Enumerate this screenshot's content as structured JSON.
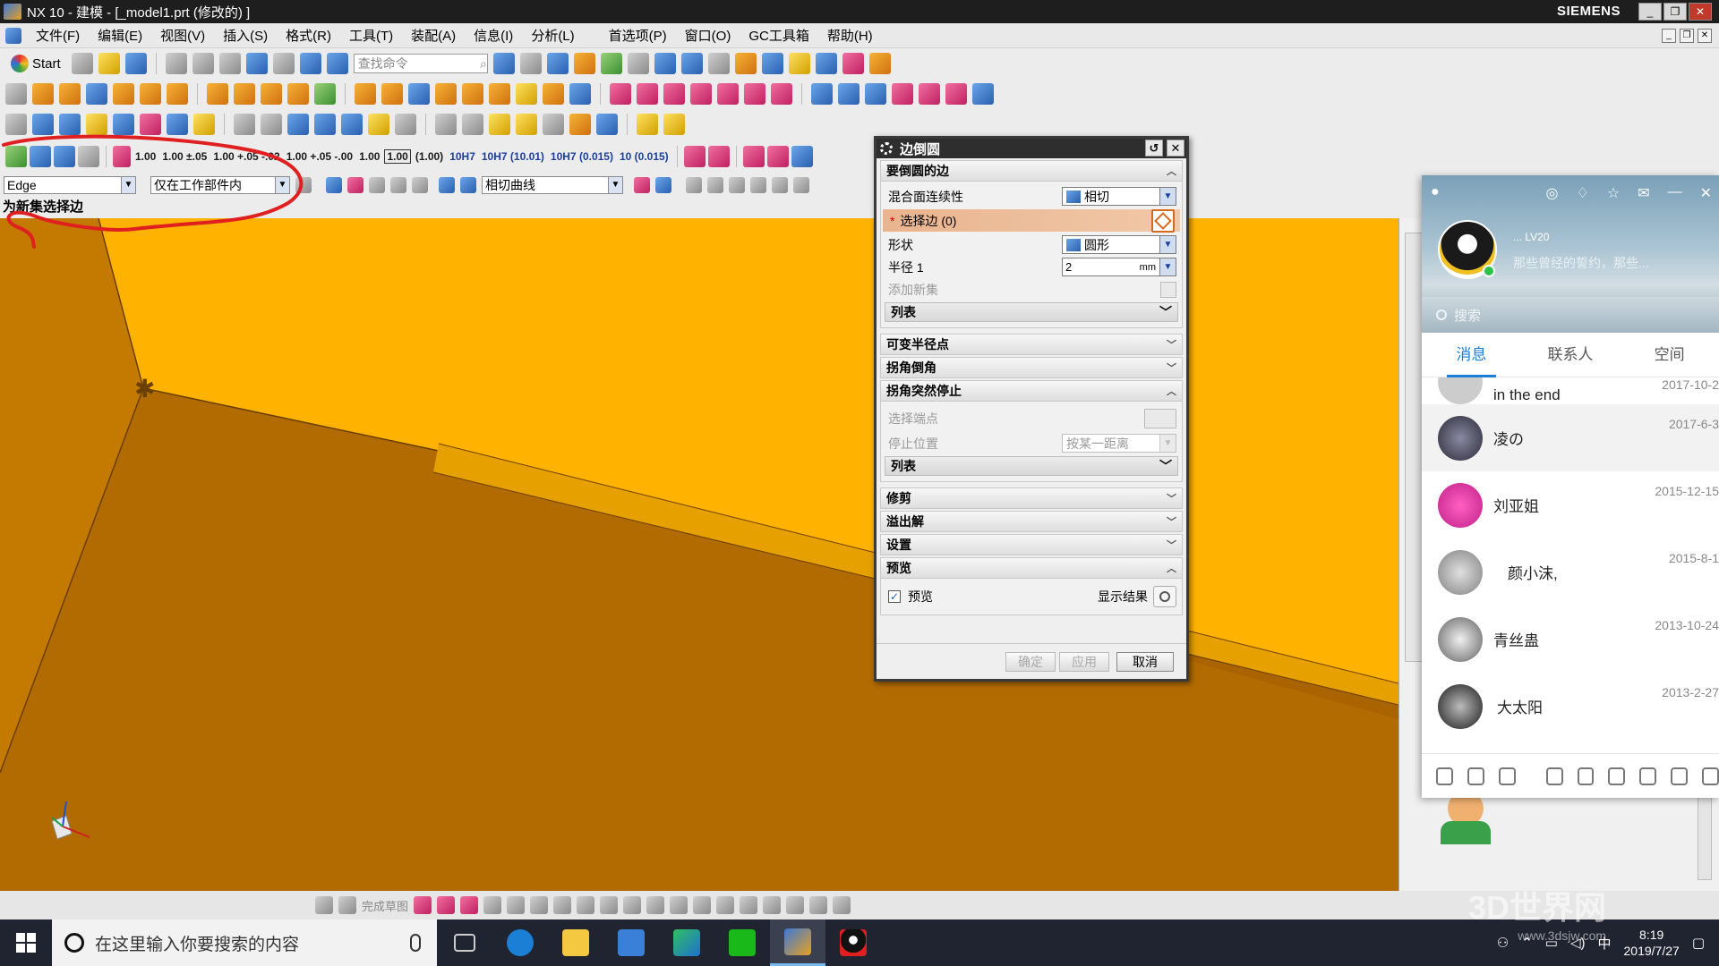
{
  "window": {
    "title": "NX 10 - 建模 - [_model1.prt  (修改的)  ]",
    "brand": "SIEMENS",
    "controls": [
      "_",
      "❐",
      "✕"
    ]
  },
  "menu": {
    "items": [
      "文件(F)",
      "编辑(E)",
      "视图(V)",
      "插入(S)",
      "格式(R)",
      "工具(T)",
      "装配(A)",
      "信息(I)",
      "分析(L)",
      "首选项(P)",
      "窗口(O)",
      "GC工具箱",
      "帮助(H)"
    ]
  },
  "toolbar": {
    "start_label": "Start",
    "search_placeholder": "查找命令",
    "dimension_labels": [
      "1.00",
      "1.00 ±.05",
      "1.00 +.05 -.02",
      "1.00 +.05 -.00",
      "1.00",
      "1.00",
      "(1.00)",
      "10H7",
      "10H7 (10.01)",
      "10H7 (0.015)",
      "10 (0.015)"
    ]
  },
  "selection_bar": {
    "filter_value": "Edge",
    "scope_value": "仅在工作部件内",
    "curve_rule": "相切曲线"
  },
  "status": {
    "prompt": "为新集选择边"
  },
  "dialog": {
    "title": "边倒圆",
    "section_edges": "要倒圆的边",
    "continuity_label": "混合面连续性",
    "continuity_value": "相切",
    "select_edge_label": "选择边 (0)",
    "shape_label": "形状",
    "shape_value": "圆形",
    "radius_label": "半径 1",
    "radius_value": "2",
    "radius_unit": "mm",
    "add_set_label": "添加新集",
    "list_label": "列表",
    "section_variable": "可变半径点",
    "section_corner_setback": "拐角倒角",
    "section_corner_stop": "拐角突然停止",
    "select_endpoint_label": "选择端点",
    "stop_position_label": "停止位置",
    "stop_position_value": "按某一距离",
    "list_label_2": "列表",
    "section_trim": "修剪",
    "section_overflow": "溢出解",
    "section_settings": "设置",
    "section_preview": "预览",
    "preview_checkbox_label": "预览",
    "show_result_label": "显示结果",
    "ok_label": "确定",
    "apply_label": "应用",
    "cancel_label": "取消"
  },
  "qq": {
    "signature": "那些曾经的誓约，那些...",
    "nickname": "... LV20",
    "search_placeholder": "搜索",
    "tabs": [
      "消息",
      "联系人",
      "空间"
    ],
    "contacts": [
      {
        "name": "in the end",
        "date": "2017-10-2"
      },
      {
        "name": "凌の",
        "date": "2017-6-3"
      },
      {
        "name": "刘亚姐",
        "date": "2015-12-15"
      },
      {
        "name": "颜小沫,",
        "date": "2015-8-1"
      },
      {
        "name": "青丝蛊",
        "date": "2013-10-24"
      },
      {
        "name": "大太阳",
        "date": "2013-2-27"
      }
    ]
  },
  "sketch_toolbar": {
    "finish_label": "完成草图"
  },
  "taskbar": {
    "search_placeholder": "在这里输入你要搜索的内容",
    "time": "8:19",
    "date": "2019/7/27",
    "ime": "中"
  },
  "watermark": {
    "text": "3D世界网",
    "url": "www.3dsjw.com"
  },
  "colors": {
    "viewport_top": "#ffb300",
    "viewport_face": "#b86e00",
    "annotation": "#e02020",
    "qq_accent": "#1a7ed6"
  }
}
